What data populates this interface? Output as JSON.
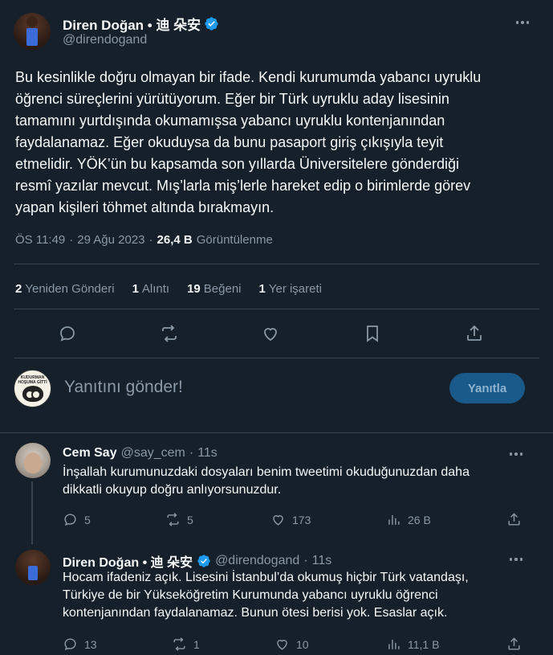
{
  "main_tweet": {
    "author_name": "Diren Doğan • 迪 朵安",
    "handle": "@direndogand",
    "lines": [
      "Bu kesinlikle doğru olmayan bir ifade. Kendi kurumumda yabancı uyruklu",
      "öğrenci süreçlerini yürütüyorum. Eğer bir Türk uyruklu aday lisesinin",
      "tamamını yurtdışında okumamışsa yabancı uyruklu kontenjanından",
      "faydalanamaz. Eğer okuduysa da bunu pasaport giriş çıkışıyla teyit",
      "etmelidir. YÖK’ün bu kapsamda son yıllarda Üniversitelere gönderdiği",
      "resmî yazılar mevcut. Mış’larla miş’lerle hareket edip o birimlerde görev",
      "yapan kişileri töhmet altında bırakmayın."
    ],
    "time": "ÖS 11:49",
    "date": "29 Ağu 2023",
    "views_count": "26,4 B",
    "views_label": "Görüntülenme",
    "stats": [
      {
        "count": "2",
        "label": "Yeniden Gönderi"
      },
      {
        "count": "1",
        "label": "Alıntı"
      },
      {
        "count": "19",
        "label": "Beğeni"
      },
      {
        "count": "1",
        "label": "Yer işareti"
      }
    ],
    "actions": [
      "reply-icon",
      "retweet-icon",
      "like-icon",
      "bookmark-icon",
      "share-icon"
    ]
  },
  "reply_box": {
    "placeholder": "Yanıtını gönder!",
    "button_label": "Yanıtla",
    "avatar_text": "KUDURMAN HOŞUMA GİTTİ"
  },
  "replies": [
    {
      "name": "Cem Say",
      "handle": "@say_cem",
      "time": "11s",
      "verified": false,
      "lines": [
        "İnşallah kurumunuzdaki dosyaları benim tweetimi okuduğunuzdan daha",
        "dikkatli okuyup doğru anlıyorsunuzdur."
      ],
      "replies": "5",
      "retweets": "5",
      "likes": "173",
      "views": "26 B"
    },
    {
      "name": "Diren Doğan • 迪 朵安",
      "handle": "@direndogand",
      "time": "11s",
      "verified": true,
      "lines": [
        "Hocam ifadeniz açık. Lisesini İstanbul’da okumuş hiçbir Türk vatandaşı,",
        "Türkiye de bir Yükseköğretim Kurumunda yabancı uyruklu öğrenci",
        "kontenjanından faydalanamaz. Bunun ötesi berisi yok. Esaslar açık."
      ],
      "replies": "13",
      "retweets": "1",
      "likes": "10",
      "views": "11,1 B"
    }
  ],
  "colors": {
    "background": "#15202b",
    "text": "#f7f9f9",
    "muted": "#8b98a5",
    "verified": "#1d9bf0",
    "button": "#1a5a8a"
  }
}
